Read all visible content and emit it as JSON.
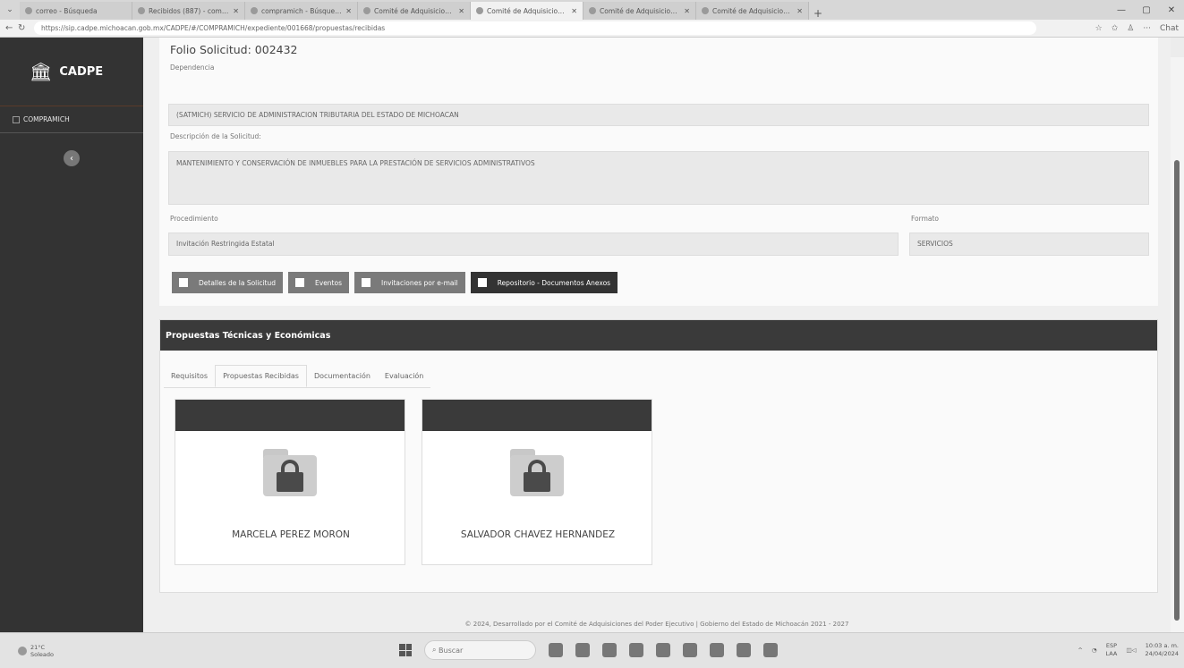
{
  "browser": {
    "tabs": [
      {
        "label": "correo - Búsqueda"
      },
      {
        "label": "Recibidos (887) - compramich@c"
      },
      {
        "label": "compramich - Búsqueda"
      },
      {
        "label": "Comité de Adquisiciones del Pod"
      },
      {
        "label": "Comité de Adquisiciones del Pod",
        "active": true
      },
      {
        "label": "Comité de Adquisiciones del Pod"
      },
      {
        "label": "Comité de Adquisiciones del Pod"
      }
    ],
    "url": "https://sip.cadpe.michoacan.gob.mx/CADPE/#/COMPRAMICH/expediente/001668/propuestas/recibidas",
    "chat_label": "Chat"
  },
  "sidebar": {
    "brand": "CADPE",
    "items": [
      {
        "label": "COMPRAMICH"
      }
    ]
  },
  "request": {
    "folio_label": "Folio Solicitud:",
    "folio_value": "002432",
    "dependencia_label": "Dependencia",
    "dependencia_value": "(SATMICH) SERVICIO DE ADMINISTRACION TRIBUTARIA DEL ESTADO DE MICHOACAN",
    "descripcion_label": "Descripción de la Solicitud:",
    "descripcion_value": "MANTENIMIENTO Y CONSERVACIÓN DE INMUEBLES PARA LA PRESTACIÓN DE SERVICIOS ADMINISTRATIVOS",
    "procedimiento_label": "Procedimiento",
    "procedimiento_value": "Invitación Restringida Estatal",
    "formato_label": "Formato",
    "formato_value": "SERVICIOS"
  },
  "actions": {
    "detalles": "Detalles de la Solicitud",
    "eventos": "Eventos",
    "invitaciones": "Invitaciones por e-mail",
    "repositorio": "Repositorio - Documentos Anexos"
  },
  "proposals": {
    "title": "Propuestas Técnicas y Económicas",
    "tabs": [
      {
        "label": "Requisitos"
      },
      {
        "label": "Propuestas Recibidas",
        "active": true
      },
      {
        "label": "Documentación"
      },
      {
        "label": "Evaluación"
      }
    ],
    "cards": [
      {
        "name": "MARCELA PEREZ MORON",
        "icon": "locked-folder-icon"
      },
      {
        "name": "SALVADOR CHAVEZ HERNANDEZ",
        "icon": "locked-folder-icon"
      }
    ]
  },
  "footer": {
    "text": "© 2024, Desarrollado por el Comité de Adquisiciones del Poder Ejecutivo | Gobierno del Estado de Michoacán 2021 - 2027"
  },
  "taskbar": {
    "weather_temp": "21°C",
    "weather_desc": "Soleado",
    "search_placeholder": "Buscar",
    "lang_top": "ESP",
    "lang_bottom": "LAA",
    "time": "10:03 a. m.",
    "date": "24/04/2024"
  },
  "colors": {
    "sidebar": "#333333",
    "panel_header": "#3a3a3a",
    "button_gray": "#7a7a7a",
    "button_dark": "#333333"
  }
}
